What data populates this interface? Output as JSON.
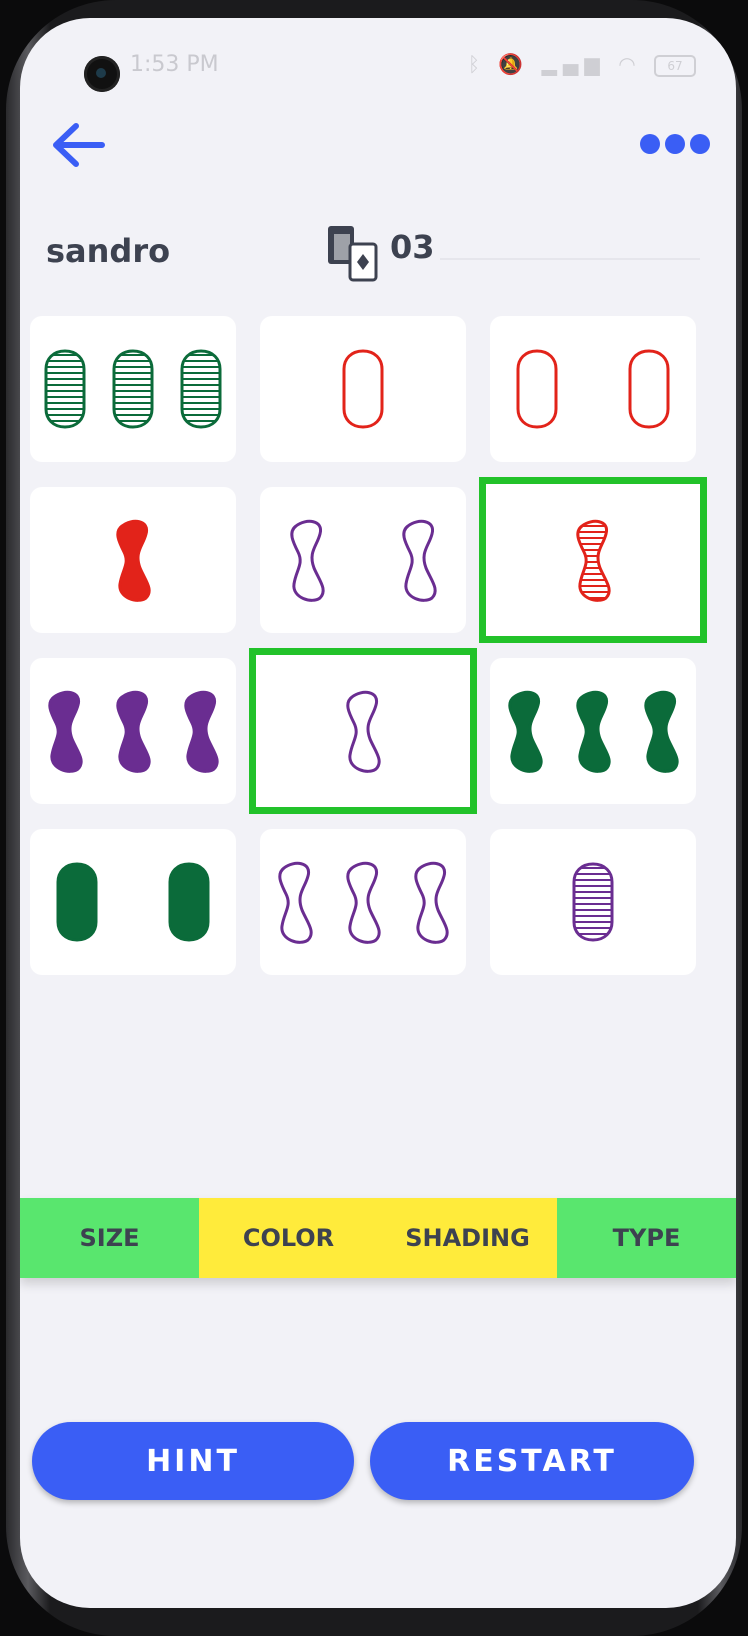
{
  "status_bar": {
    "time": "1:53 PM",
    "battery": "67"
  },
  "header": {
    "player_name": "sandro",
    "deck_count": "03"
  },
  "colors": {
    "green": "#0b6b3a",
    "red": "#e2231a",
    "purple": "#6a2d91",
    "accent": "#3a5ef5",
    "selection": "#22c22a"
  },
  "cards": [
    {
      "count": 3,
      "shape": "oval",
      "color": "green",
      "shading": "striped",
      "selected": false
    },
    {
      "count": 1,
      "shape": "oval",
      "color": "red",
      "shading": "outline",
      "selected": false
    },
    {
      "count": 2,
      "shape": "oval",
      "color": "red",
      "shading": "outline",
      "selected": false
    },
    {
      "count": 1,
      "shape": "squiggle",
      "color": "red",
      "shading": "solid",
      "selected": false
    },
    {
      "count": 2,
      "shape": "squiggle",
      "color": "purple",
      "shading": "outline",
      "selected": false
    },
    {
      "count": 1,
      "shape": "squiggle",
      "color": "red",
      "shading": "striped",
      "selected": true
    },
    {
      "count": 3,
      "shape": "squiggle",
      "color": "purple",
      "shading": "solid",
      "selected": false
    },
    {
      "count": 1,
      "shape": "squiggle",
      "color": "purple",
      "shading": "outline",
      "selected": true
    },
    {
      "count": 3,
      "shape": "squiggle",
      "color": "green",
      "shading": "solid",
      "selected": false
    },
    {
      "count": 2,
      "shape": "oval",
      "color": "green",
      "shading": "solid",
      "selected": false
    },
    {
      "count": 3,
      "shape": "squiggle",
      "color": "purple",
      "shading": "outline",
      "selected": false
    },
    {
      "count": 1,
      "shape": "oval",
      "color": "purple",
      "shading": "striped",
      "selected": false
    }
  ],
  "attributes": [
    {
      "label": "SIZE",
      "state": "match"
    },
    {
      "label": "COLOR",
      "state": "mismatch"
    },
    {
      "label": "SHADING",
      "state": "mismatch"
    },
    {
      "label": "TYPE",
      "state": "match"
    }
  ],
  "buttons": {
    "hint": "HINT",
    "restart": "RESTART"
  }
}
